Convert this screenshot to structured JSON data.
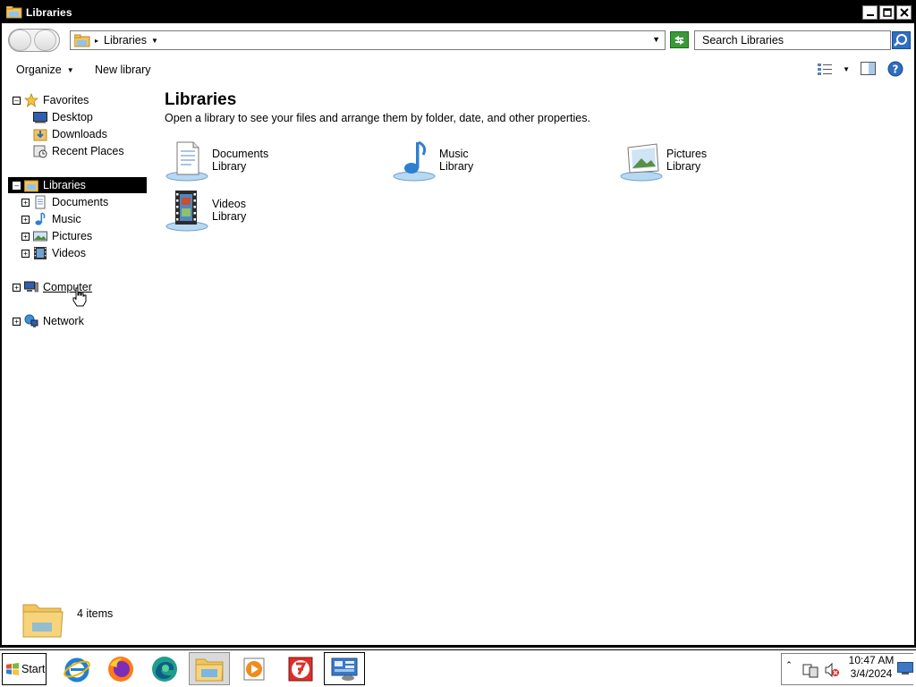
{
  "window": {
    "title": "Libraries"
  },
  "address": {
    "crumb": "Libraries",
    "search_placeholder": "Search Libraries"
  },
  "toolbar": {
    "organize_label": "Organize",
    "new_library_label": "New library"
  },
  "nav": {
    "favorites": "Favorites",
    "favorites_items": [
      "Desktop",
      "Downloads",
      "Recent Places"
    ],
    "libraries": "Libraries",
    "libraries_items": [
      "Documents",
      "Music",
      "Pictures",
      "Videos"
    ],
    "computer": "Computer",
    "network": "Network"
  },
  "content": {
    "title": "Libraries",
    "subtitle": "Open a library to see your files and arrange them by folder, date, and other properties.",
    "libraries": [
      {
        "name": "Documents",
        "type": "Library",
        "icon": "documents-library-icon"
      },
      {
        "name": "Music",
        "type": "Library",
        "icon": "music-library-icon"
      },
      {
        "name": "Pictures",
        "type": "Library",
        "icon": "pictures-library-icon"
      },
      {
        "name": "Videos",
        "type": "Library",
        "icon": "videos-library-icon"
      }
    ]
  },
  "status": {
    "item_count": "4 items"
  },
  "taskbar": {
    "start_label": "Start",
    "clock_time": "10:47 AM",
    "clock_date": "3/4/2024"
  },
  "colors": {
    "selection": "#000000",
    "folder_yellow": "#f2c45c",
    "library_blue": "#5b9bd5"
  }
}
